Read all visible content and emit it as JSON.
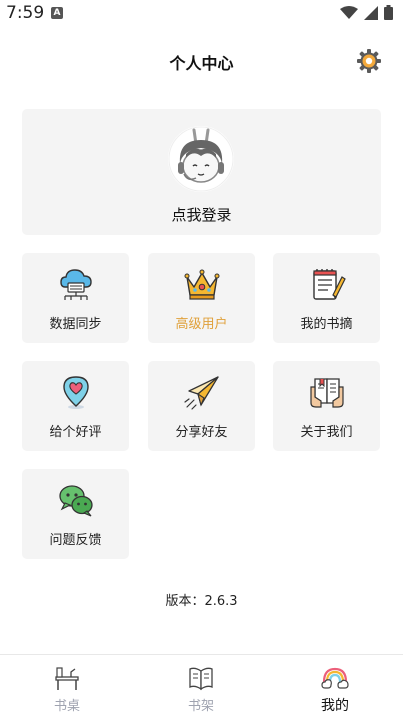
{
  "status_bar": {
    "time": "7:59",
    "notification_badge": "A"
  },
  "header": {
    "title": "个人中心",
    "settings_icon": "gear-icon"
  },
  "login": {
    "label": "点我登录",
    "avatar_icon": "avatar-icon"
  },
  "menu": [
    {
      "label": "数据同步",
      "icon": "cloud-sync-icon",
      "highlight": false
    },
    {
      "label": "高级用户",
      "icon": "crown-icon",
      "highlight": true,
      "color": "#e0a03a"
    },
    {
      "label": "我的书摘",
      "icon": "notebook-pencil-icon",
      "highlight": false
    },
    {
      "label": "给个好评",
      "icon": "heart-pin-icon",
      "highlight": false
    },
    {
      "label": "分享好友",
      "icon": "paper-plane-icon",
      "highlight": false
    },
    {
      "label": "关于我们",
      "icon": "book-hands-icon",
      "highlight": false
    },
    {
      "label": "问题反馈",
      "icon": "chat-bubbles-icon",
      "highlight": false
    }
  ],
  "version": "版本：2.6.3",
  "tabbar": {
    "tabs": [
      {
        "label": "书桌",
        "icon": "desk-icon",
        "active": false
      },
      {
        "label": "书架",
        "icon": "book-icon",
        "active": false
      },
      {
        "label": "我的",
        "icon": "rainbow-cloud-icon",
        "active": true
      }
    ],
    "inactive_color": "#9fa3b0",
    "active_color": "#111111"
  }
}
